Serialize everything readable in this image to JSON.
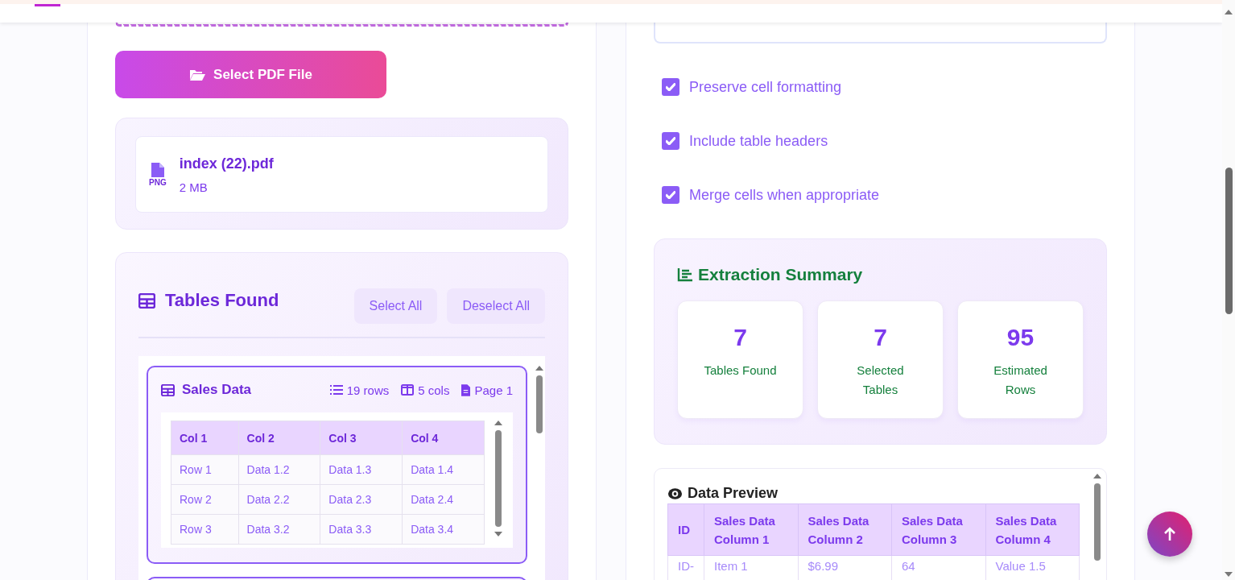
{
  "upload": {
    "button": "Select PDF File"
  },
  "file": {
    "name": "index (22).pdf",
    "size": "2 MB",
    "badge": "PNG"
  },
  "tables_found": {
    "title": "Tables Found",
    "buttons": [
      "Select All",
      "Deselect All"
    ],
    "tables": [
      {
        "title": "Sales Data",
        "rows": "19 rows",
        "cols": "5 cols",
        "page": "Page 1",
        "columns": [
          "Col 1",
          "Col 2",
          "Col 3",
          "Col 4"
        ],
        "cells": [
          [
            "Row 1",
            "Data 1.2",
            "Data 1.3",
            "Data 1.4"
          ],
          [
            "Row 2",
            "Data 2.2",
            "Data 2.3",
            "Data 2.4"
          ],
          [
            "Row 3",
            "Data 3.2",
            "Data 3.3",
            "Data 3.4"
          ]
        ]
      }
    ]
  },
  "options": [
    {
      "label": "Preserve cell formatting",
      "checked": true
    },
    {
      "label": "Include table headers",
      "checked": true
    },
    {
      "label": "Merge cells when appropriate",
      "checked": true
    }
  ],
  "summary": {
    "title": "Extraction Summary",
    "stats": [
      {
        "value": "7",
        "label": "Tables Found"
      },
      {
        "value": "7",
        "label": "Selected Tables"
      },
      {
        "value": "95",
        "label": "Estimated Rows"
      }
    ]
  },
  "preview": {
    "title": "Data Preview",
    "columns": [
      "ID",
      "Sales Data Column 1",
      "Sales Data Column 2",
      "Sales Data Column 3",
      "Sales Data Column 4"
    ],
    "rows": [
      [
        "ID-",
        "Item 1",
        "$6.99",
        "64",
        "Value 1.5"
      ]
    ]
  }
}
